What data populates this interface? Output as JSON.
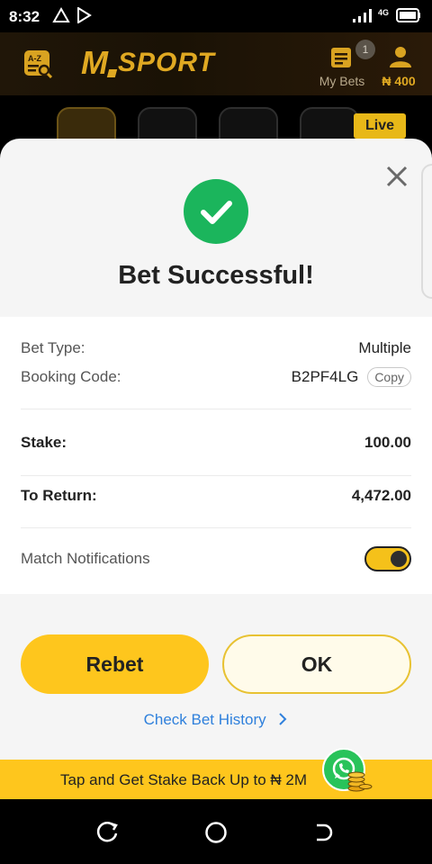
{
  "status_bar": {
    "time": "8:32",
    "network": "4G"
  },
  "header": {
    "brand": "SPORT",
    "brand_letter": "M",
    "az_label": "A-Z",
    "my_bets_label": "My Bets",
    "my_bets_badge": "1",
    "balance_label": "₦ 400",
    "accent_color": "#e0a922"
  },
  "live_tab_label": "Live",
  "modal": {
    "title": "Bet Successful!",
    "rows": {
      "bet_type_label": "Bet Type:",
      "bet_type_value": "Multiple",
      "booking_code_label": "Booking Code:",
      "booking_code_value": "B2PF4LG",
      "copy_label": "Copy",
      "stake_label": "Stake:",
      "stake_value": "100.00",
      "to_return_label": "To Return:",
      "to_return_value": "4,472.00",
      "notifications_label": "Match Notifications",
      "notifications_on": true
    },
    "rebet_label": "Rebet",
    "ok_label": "OK",
    "history_link": "Check Bet History",
    "success_color": "#1bb55c",
    "primary_color": "#fec61d",
    "link_color": "#2f80dc"
  },
  "promo": {
    "text": "Tap and Get Stake Back Up to ₦ 2M"
  }
}
